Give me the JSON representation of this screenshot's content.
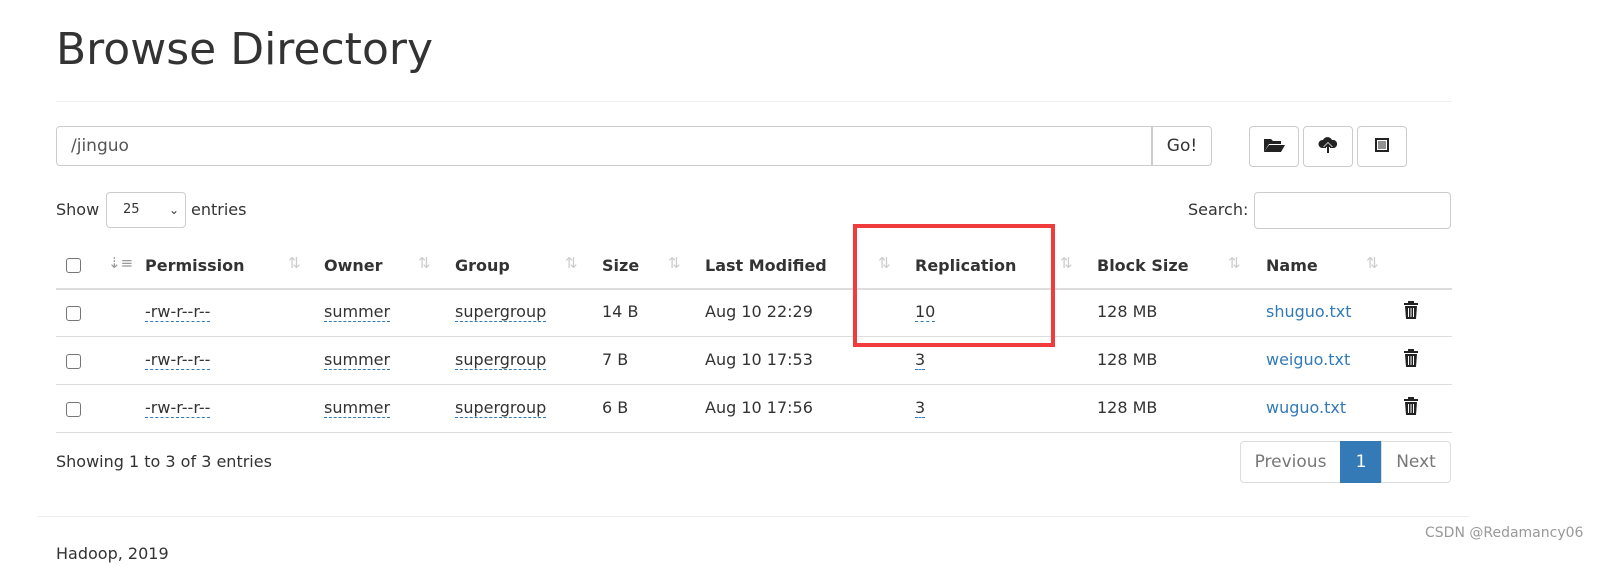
{
  "title": "Browse Directory",
  "path_input": "/jinguo",
  "go_label": "Go!",
  "toolbar": [
    {
      "icon": "folder-open-icon"
    },
    {
      "icon": "cloud-upload-icon"
    },
    {
      "icon": "list-alt-icon"
    }
  ],
  "show_label": "Show",
  "entries_value": "25",
  "entries_label": "entries",
  "search_label": "Search:",
  "columns": [
    "Permission",
    "Owner",
    "Group",
    "Size",
    "Last Modified",
    "Replication",
    "Block Size",
    "Name"
  ],
  "rows": [
    {
      "permission": "-rw-r--r--",
      "owner": "summer",
      "group": "supergroup",
      "size": "14 B",
      "modified": "Aug 10 22:29",
      "replication": "10",
      "block": "128 MB",
      "name": "shuguo.txt"
    },
    {
      "permission": "-rw-r--r--",
      "owner": "summer",
      "group": "supergroup",
      "size": "7 B",
      "modified": "Aug 10 17:53",
      "replication": "3",
      "block": "128 MB",
      "name": "weiguo.txt"
    },
    {
      "permission": "-rw-r--r--",
      "owner": "summer",
      "group": "supergroup",
      "size": "6 B",
      "modified": "Aug 10 17:56",
      "replication": "3",
      "block": "128 MB",
      "name": "wuguo.txt"
    }
  ],
  "info": "Showing 1 to 3 of 3 entries",
  "pagination": {
    "previous": "Previous",
    "page": "1",
    "next": "Next"
  },
  "footer": "Hadoop, 2019",
  "watermark": "CSDN @Redamancy06",
  "highlight_color": "#f03c3c",
  "accent": "#337ab7"
}
